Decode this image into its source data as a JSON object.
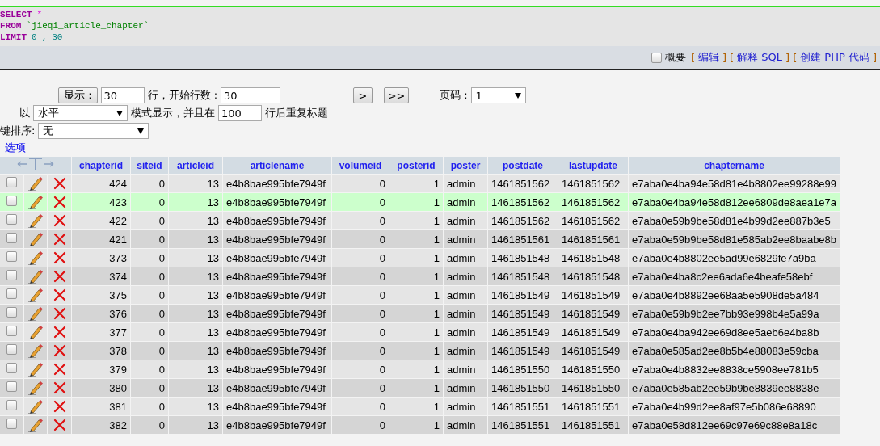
{
  "sql": {
    "lines": [
      [
        {
          "kind": "keyword",
          "text": "SELECT"
        },
        {
          "kind": "operator",
          "text": "*"
        }
      ],
      [
        {
          "kind": "keyword",
          "text": "FROM"
        },
        {
          "kind": "name",
          "text": "`jieqi_article_chapter`"
        }
      ],
      [
        {
          "kind": "keyword",
          "text": "LIMIT"
        },
        {
          "kind": "number",
          "text": "0"
        },
        {
          "kind": "punct",
          "text": ","
        },
        {
          "kind": "number",
          "text": "30"
        }
      ]
    ]
  },
  "sql_toolbar": {
    "profile": {
      "label": "概要",
      "checked": false
    },
    "links": [
      {
        "open": "[",
        "label": "编辑",
        "close": "]"
      },
      {
        "open": "[",
        "label": "解释 SQL",
        "close": "]"
      },
      {
        "open": "[",
        "label": "创建 PHP 代码",
        "close": "]"
      }
    ]
  },
  "navigation": {
    "show_button": "显示 :",
    "rows_value": "30",
    "rows_label": "行，开始行数 :",
    "start_value": "30",
    "next_button": ">",
    "last_button": ">>",
    "page_label": "页码 :",
    "page_value": "1",
    "mode_prefix": "以",
    "mode_value": "水平",
    "mode_label": "模式显示，并且在",
    "repeat_value": "100",
    "repeat_label": "行后重复标题",
    "sort_label": "键排序:",
    "sort_value": "无",
    "options_link": "选项"
  },
  "table": {
    "columns": [
      "chapterid",
      "siteid",
      "articleid",
      "articlename",
      "volumeid",
      "posterid",
      "poster",
      "postdate",
      "lastupdate",
      "chaptername"
    ],
    "rows": [
      {
        "checked": false,
        "highlighted": false,
        "cells": [
          "424",
          "0",
          "13",
          "e4b8bae995bfe7949f",
          "0",
          "1",
          "admin",
          "1461851562",
          "1461851562",
          "e7aba0e4ba94e58d81e4b8802ee99288e99"
        ]
      },
      {
        "checked": false,
        "highlighted": true,
        "cells": [
          "423",
          "0",
          "13",
          "e4b8bae995bfe7949f",
          "0",
          "1",
          "admin",
          "1461851562",
          "1461851562",
          "e7aba0e4ba94e58d812ee6809de8aea1e7a"
        ]
      },
      {
        "checked": false,
        "highlighted": false,
        "cells": [
          "422",
          "0",
          "13",
          "e4b8bae995bfe7949f",
          "0",
          "1",
          "admin",
          "1461851562",
          "1461851562",
          "e7aba0e59b9be58d81e4b99d2ee887b3e5"
        ]
      },
      {
        "checked": false,
        "highlighted": false,
        "cells": [
          "421",
          "0",
          "13",
          "e4b8bae995bfe7949f",
          "0",
          "1",
          "admin",
          "1461851561",
          "1461851561",
          "e7aba0e59b9be58d81e585ab2ee8baabe8b"
        ]
      },
      {
        "checked": false,
        "highlighted": false,
        "cells": [
          "373",
          "0",
          "13",
          "e4b8bae995bfe7949f",
          "0",
          "1",
          "admin",
          "1461851548",
          "1461851548",
          "e7aba0e4b8802ee5ad99e6829fe7a9ba"
        ]
      },
      {
        "checked": false,
        "highlighted": false,
        "cells": [
          "374",
          "0",
          "13",
          "e4b8bae995bfe7949f",
          "0",
          "1",
          "admin",
          "1461851548",
          "1461851548",
          "e7aba0e4ba8c2ee6ada6e4beafe58ebf"
        ]
      },
      {
        "checked": false,
        "highlighted": false,
        "cells": [
          "375",
          "0",
          "13",
          "e4b8bae995bfe7949f",
          "0",
          "1",
          "admin",
          "1461851549",
          "1461851549",
          "e7aba0e4b8892ee68aa5e5908de5a484"
        ]
      },
      {
        "checked": false,
        "highlighted": false,
        "cells": [
          "376",
          "0",
          "13",
          "e4b8bae995bfe7949f",
          "0",
          "1",
          "admin",
          "1461851549",
          "1461851549",
          "e7aba0e59b9b2ee7bb93e998b4e5a99a"
        ]
      },
      {
        "checked": false,
        "highlighted": false,
        "cells": [
          "377",
          "0",
          "13",
          "e4b8bae995bfe7949f",
          "0",
          "1",
          "admin",
          "1461851549",
          "1461851549",
          "e7aba0e4ba942ee69d8ee5aeb6e4ba8b"
        ]
      },
      {
        "checked": false,
        "highlighted": false,
        "cells": [
          "378",
          "0",
          "13",
          "e4b8bae995bfe7949f",
          "0",
          "1",
          "admin",
          "1461851549",
          "1461851549",
          "e7aba0e585ad2ee8b5b4e88083e59cba"
        ]
      },
      {
        "checked": false,
        "highlighted": false,
        "cells": [
          "379",
          "0",
          "13",
          "e4b8bae995bfe7949f",
          "0",
          "1",
          "admin",
          "1461851550",
          "1461851550",
          "e7aba0e4b8832ee8838ce5908ee781b5"
        ]
      },
      {
        "checked": false,
        "highlighted": false,
        "cells": [
          "380",
          "0",
          "13",
          "e4b8bae995bfe7949f",
          "0",
          "1",
          "admin",
          "1461851550",
          "1461851550",
          "e7aba0e585ab2ee59b9be8839ee8838e"
        ]
      },
      {
        "checked": false,
        "highlighted": false,
        "cells": [
          "381",
          "0",
          "13",
          "e4b8bae995bfe7949f",
          "0",
          "1",
          "admin",
          "1461851551",
          "1461851551",
          "e7aba0e4b99d2ee8af97e5b086e68890"
        ]
      },
      {
        "checked": false,
        "highlighted": false,
        "cells": [
          "382",
          "0",
          "13",
          "e4b8bae995bfe7949f",
          "0",
          "1",
          "admin",
          "1461851551",
          "1461851551",
          "e7aba0e58d812ee69c97e69c88e8a18c"
        ]
      }
    ]
  }
}
